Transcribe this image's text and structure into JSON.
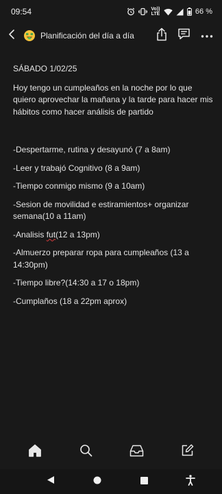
{
  "status_bar": {
    "time": "09:54",
    "network_label": "Vo)) LTE",
    "battery": "66 %"
  },
  "app_bar": {
    "title": "Planificación del día a día"
  },
  "note": {
    "date_line": "SÁBADO 1/02/25",
    "intro": "Hoy tengo un cumpleaños en la noche por lo que quiero aprovechar la mañana y la tarde para hacer mis hábitos como hacer análisis de partido",
    "items": [
      "-Despertarme, rutina y desayunó (7 a 8am)",
      "-Leer y trabajó Cognitivo (8 a 9am)",
      "-Tiempo conmigo mismo (9 a 10am)",
      "-Sesion de movilidad e estiramientos+ organizar semana(10 a 11am)",
      "-Analisis ",
      "-Almuerzo preparar ropa para cumpleaños (13 a 14:30pm)",
      "-Tiempo libre?(14:30 a 17 o 18pm)",
      "-Cumplaños (18 a 22pm aprox)"
    ],
    "item5_word": "fut",
    "item5_rest": "(12 a 13pm)"
  },
  "icons": {
    "back": "chevron-left-icon",
    "emoji": "money-mouth-face-icon",
    "share": "share-icon",
    "comment": "comment-icon",
    "more": "more-horizontal-icon",
    "home": "home-icon",
    "search": "search-icon",
    "inbox": "inbox-icon",
    "compose": "compose-icon"
  },
  "colors": {
    "background": "#191919",
    "text": "#e4e4e4",
    "spellcheck": "#d93c3c",
    "emoji": "#f5c43b"
  }
}
